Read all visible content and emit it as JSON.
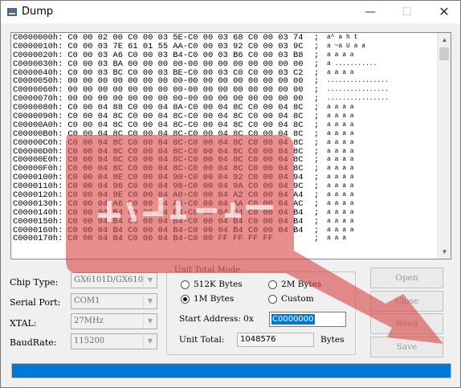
{
  "window": {
    "title": "Dump",
    "minimize": "—",
    "maximize": "☐",
    "close": "✕"
  },
  "dump": {
    "rows": [
      {
        "addr": "C0000000h:",
        "hex": "C0 00 02 00 C0 00 03 5E-C0 00 03 68 C0 00 03 74",
        "sep": ";",
        "ascii": "a^ a h t"
      },
      {
        "addr": "C0000010h:",
        "hex": "C0 00 03 7E 61 01 55 AA-C0 00 03 92 C0 00 03 9C",
        "sep": ";",
        "ascii": "a ~a U a a"
      },
      {
        "addr": "C0000020h:",
        "hex": "C0 00 03 A6 C0 00 03 B4-C0 00 03 B6 C0 00 03 B8",
        "sep": ";",
        "ascii": "a a a a"
      },
      {
        "addr": "C0000030h:",
        "hex": "C0 00 03 BA 00 00 00 00-00 00 00 00 00 00 00 00",
        "sep": ";",
        "ascii": "a ..........."
      },
      {
        "addr": "C0000040h:",
        "hex": "C0 00 03 BC C0 00 03 BE-C0 00 03 C0 C0 00 03 C2",
        "sep": ";",
        "ascii": "a a a a"
      },
      {
        "addr": "C0000050h:",
        "hex": "00 00 00 00 00 00 00 00-00 00 00 00 00 00 00 00",
        "sep": ";",
        "ascii": "................"
      },
      {
        "addr": "C0000060h:",
        "hex": "00 00 00 00 00 00 00 00-00 00 00 00 00 00 00 00",
        "sep": ";",
        "ascii": "................"
      },
      {
        "addr": "C0000070h:",
        "hex": "00 00 00 00 00 00 00 00-00 00 00 00 00 00 00 00",
        "sep": ";",
        "ascii": "................"
      },
      {
        "addr": "C0000080h:",
        "hex": "C0 00 04 88 C0 00 04 8A-C0 00 04 8C C0 00 04 8C",
        "sep": ";",
        "ascii": "a a a a"
      },
      {
        "addr": "C0000090h:",
        "hex": "C0 00 04 8C C0 00 04 8C-C0 00 04 8C C0 00 04 8C",
        "sep": ";",
        "ascii": "a a a a"
      },
      {
        "addr": "C00000A0h:",
        "hex": "C0 00 04 8C C0 00 04 8C-C0 00 04 8C C0 00 04 8C",
        "sep": ";",
        "ascii": "a a a a"
      },
      {
        "addr": "C00000B0h:",
        "hex": "C0 00 04 8C C0 00 04 8C-C0 00 04 8C C0 00 04 8C",
        "sep": ";",
        "ascii": "a a a a"
      },
      {
        "addr": "C00000C0h:",
        "hex": "C0 00 04 8C C0 00 04 8C-C0 00 04 8C C0 00 04 8C",
        "sep": ";",
        "ascii": "a a a a"
      },
      {
        "addr": "C00000D0h:",
        "hex": "C0 00 04 8C C0 00 04 8C-C0 00 04 8C C0 00 04 8C",
        "sep": ";",
        "ascii": "a a a a"
      },
      {
        "addr": "C00000E0h:",
        "hex": "C0 00 04 8C C0 00 04 8C-C0 00 04 8C C0 00 04 8C",
        "sep": ";",
        "ascii": "a a a a"
      },
      {
        "addr": "C00000F0h:",
        "hex": "C0 00 04 8C C0 00 04 8C-C0 00 04 8C C0 00 04 8C",
        "sep": ";",
        "ascii": "a a a a"
      },
      {
        "addr": "C0000100h:",
        "hex": "C0 00 04 8E C0 00 04 90-C0 00 04 92 C0 00 04 94",
        "sep": ";",
        "ascii": "a a a a"
      },
      {
        "addr": "C0000110h:",
        "hex": "C0 00 04 96 C0 00 04 98-C0 00 04 9A C0 00 04 9C",
        "sep": ";",
        "ascii": "a a a a"
      },
      {
        "addr": "C0000120h:",
        "hex": "C0 00 04 9E C0 00 04 A0-C0 00 04 A2 C0 00 04 A4",
        "sep": ";",
        "ascii": "a a a a"
      },
      {
        "addr": "C0000130h:",
        "hex": "C0 00 04 A6 C0 00 04 A8-C0 00 04 AA C0 00 04 AC",
        "sep": ";",
        "ascii": "a a a a"
      },
      {
        "addr": "C0000140h:",
        "hex": "C0 00 04 B4 C0 00 04 B4-C0 00 04 B4 C0 00 04 B4",
        "sep": ";",
        "ascii": "a a a a"
      },
      {
        "addr": "C0000150h:",
        "hex": "C0 00 04 B4 C0 00 04 B4-C0 00 04 B4 C0 00 04 B4",
        "sep": ";",
        "ascii": "a a a a"
      },
      {
        "addr": "C0000160h:",
        "hex": "C0 00 04 B4 C0 00 04 B4-C0 00 04 B4 C0 00 04 B4",
        "sep": ";",
        "ascii": "a a a a"
      },
      {
        "addr": "C0000170h:",
        "hex": "C0 00 04 B4 C0 00 04 B4-C0 00 FF FF FF FF",
        "sep": ";",
        "ascii": "a a a"
      }
    ]
  },
  "form": {
    "chip_type": {
      "label": "Chip Type:",
      "value": "GX6101D/GX6101M"
    },
    "serial_port": {
      "label": "Serial Port:",
      "value": "COM1"
    },
    "xtal": {
      "label": "XTAL:",
      "value": "27MHz"
    },
    "baudrate": {
      "label": "BaudRate:",
      "value": "115200"
    }
  },
  "unit_mode": {
    "title": "Unit Total Mode",
    "options": [
      {
        "label": "512K Bytes",
        "selected": false
      },
      {
        "label": "2M Bytes",
        "selected": false
      },
      {
        "label": "1M Bytes",
        "selected": true
      },
      {
        "label": "Custom",
        "selected": false
      }
    ],
    "start_address_label": "Start Address: 0x",
    "start_address_value": "C0000000",
    "unit_total_label": "Unit Total:",
    "unit_total_value": "1048576",
    "unit_total_suffix": "Bytes"
  },
  "buttons": {
    "open": "Open",
    "close": "Close",
    "read": "Read",
    "save": "Save"
  },
  "progress": {
    "value": 1.0
  },
  "colors": {
    "accent": "#0078d7",
    "overlay": "#d94a4a"
  }
}
